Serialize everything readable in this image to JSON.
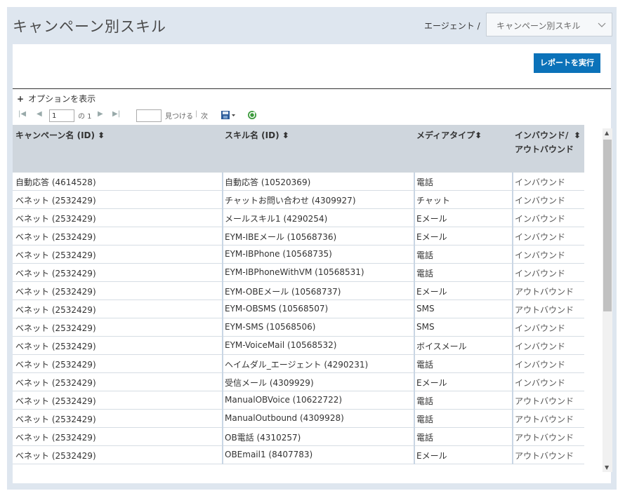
{
  "page": {
    "title": "キャンペーン別スキル"
  },
  "breadcrumb": {
    "label": "エージェント /"
  },
  "report_select": {
    "value": "キャンペーン別スキル"
  },
  "run_button": {
    "label": "レポートを実行"
  },
  "options": {
    "label": "オプションを表示"
  },
  "toolbar": {
    "page_value": "1",
    "of_label": "の 1",
    "find_label": "見つける",
    "next_label": "次"
  },
  "table": {
    "headers": [
      "キャンペーン名 (ID)",
      "スキル名 (ID)",
      "メディアタイプ",
      "インバウンド/ アウトバウンド"
    ],
    "rows": [
      [
        "自動応答 (4614528)",
        "自動応答 (10520369)",
        "電話",
        "インバウンド"
      ],
      [
        "ベネット (2532429)",
        "チャットお問い合わせ (4309927)",
        "チャット",
        "インバウンド"
      ],
      [
        "ベネット (2532429)",
        "メールスキル1 (4290254)",
        "Eメール",
        "インバウンド"
      ],
      [
        "ベネット (2532429)",
        "EYM-IBEメール (10568736)",
        "Eメール",
        "インバウンド"
      ],
      [
        "ベネット (2532429)",
        "EYM-IBPhone (10568735)",
        "電話",
        "インバウンド"
      ],
      [
        "ベネット (2532429)",
        "EYM-IBPhoneWithVM (10568531)",
        "電話",
        "インバウンド"
      ],
      [
        "ベネット (2532429)",
        "EYM-OBEメール (10568737)",
        "Eメール",
        "アウトバウンド"
      ],
      [
        "ベネット (2532429)",
        "EYM-OBSMS (10568507)",
        "SMS",
        "アウトバウンド"
      ],
      [
        "ベネット (2532429)",
        "EYM-SMS (10568506)",
        "SMS",
        "インバウンド"
      ],
      [
        "ベネット (2532429)",
        "EYM-VoiceMail (10568532)",
        "ボイスメール",
        "インバウンド"
      ],
      [
        "ベネット (2532429)",
        "ヘイムダル_エージェント (4290231)",
        "電話",
        "インバウンド"
      ],
      [
        "ベネット (2532429)",
        "受信メール (4309929)",
        "Eメール",
        "インバウンド"
      ],
      [
        "ベネット (2532429)",
        "ManualOBVoice (10622722)",
        "電話",
        "アウトバウンド"
      ],
      [
        "ベネット (2532429)",
        "ManualOutbound (4309928)",
        "電話",
        "アウトバウンド"
      ],
      [
        "ベネット (2532429)",
        "OB電話 (4310257)",
        "電話",
        "アウトバウンド"
      ],
      [
        "ベネット (2532429)",
        "OBEmail1 (8407783)",
        "Eメール",
        "アウトバウンド"
      ]
    ]
  }
}
